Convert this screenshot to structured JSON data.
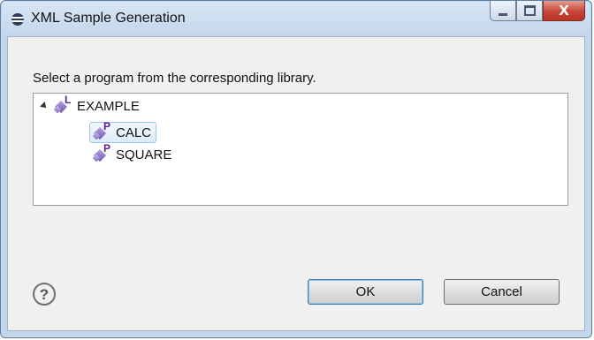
{
  "window": {
    "title": "XML Sample Generation",
    "icon": "eclipse-icon",
    "controls": {
      "minimize_icon": "minimize-icon",
      "maximize_icon": "maximize-icon",
      "close_glyph": "X"
    }
  },
  "dialog": {
    "instruction": "Select a program from the corresponding library.",
    "tree": {
      "library": {
        "label": "EXAMPLE",
        "badge": "L",
        "expanded": true
      },
      "programs": [
        {
          "label": "CALC",
          "badge": "P",
          "selected": true
        },
        {
          "label": "SQUARE",
          "badge": "P",
          "selected": false
        }
      ]
    },
    "help_glyph": "?",
    "buttons": {
      "ok_label": "OK",
      "cancel_label": "Cancel"
    }
  },
  "colors": {
    "selection_border": "#99c3ec",
    "default_button_border": "#3c7fb1",
    "close_button": "#c6473a"
  }
}
